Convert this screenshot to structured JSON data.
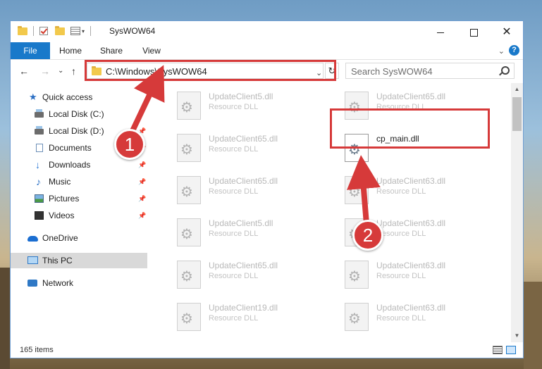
{
  "window": {
    "title": "SysWOW64",
    "caption": {
      "minimize": "",
      "maximize": "",
      "close": "✕"
    }
  },
  "ribbon": {
    "tabs": [
      "File",
      "Home",
      "Share",
      "View"
    ],
    "chevron": "⌄",
    "help": "?"
  },
  "nav": {
    "back": "←",
    "forward": "→",
    "recent": "⌄",
    "up": "↑",
    "address": "C:\\Windows\\SysWOW64",
    "address_drop": "⌄",
    "refresh": "↻",
    "search_placeholder": "Search SysWOW64"
  },
  "sidebar": {
    "items": [
      {
        "label": "Quick access",
        "icon": "star-icon",
        "pinned": false
      },
      {
        "label": "Local Disk (C:)",
        "icon": "disk-icon",
        "pinned": false
      },
      {
        "label": "Local Disk (D:)",
        "icon": "disk-icon",
        "pinned": true
      },
      {
        "label": "Documents",
        "icon": "documents-icon",
        "pinned": true
      },
      {
        "label": "Downloads",
        "icon": "downloads-icon",
        "pinned": true
      },
      {
        "label": "Music",
        "icon": "music-icon",
        "pinned": true
      },
      {
        "label": "Pictures",
        "icon": "pictures-icon",
        "pinned": true
      },
      {
        "label": "Videos",
        "icon": "videos-icon",
        "pinned": true
      },
      {
        "label": "OneDrive",
        "icon": "onedrive-icon",
        "pinned": false
      },
      {
        "label": "This PC",
        "icon": "this-pc-icon",
        "pinned": false,
        "selected": true
      },
      {
        "label": "Network",
        "icon": "network-icon",
        "pinned": false
      }
    ],
    "pin_glyph": "📌"
  },
  "files": {
    "col1": [
      {
        "name": "UpdateClient5.dll",
        "type": "Resource DLL"
      },
      {
        "name": "UpdateClient65.dll",
        "type": "Resource DLL"
      },
      {
        "name": "UpdateClient65.dll",
        "type": "Resource DLL"
      },
      {
        "name": "UpdateClient5.dll",
        "type": "Resource DLL"
      },
      {
        "name": "UpdateClient65.dll",
        "type": "Resource DLL"
      },
      {
        "name": "UpdateClient19.dll",
        "type": "Resource DLL"
      }
    ],
    "col2": [
      {
        "name": "UpdateClient65.dll",
        "type": "Resource DLL"
      },
      {
        "name": "cp_main.dll",
        "type": "",
        "active": true
      },
      {
        "name": "UpdateClient63.dll",
        "type": "Resource DLL"
      },
      {
        "name": "UpdateClient63.dll",
        "type": "Resource DLL"
      },
      {
        "name": "UpdateClient63.dll",
        "type": "Resource DLL"
      },
      {
        "name": "UpdateClient63.dll",
        "type": "Resource DLL"
      }
    ]
  },
  "status": {
    "items_count": "165 items"
  },
  "annotations": {
    "badge1": "1",
    "badge2": "2",
    "color": "#d63a3a"
  },
  "colors": {
    "accent": "#1979ca",
    "selection": "#d9d9d9"
  }
}
